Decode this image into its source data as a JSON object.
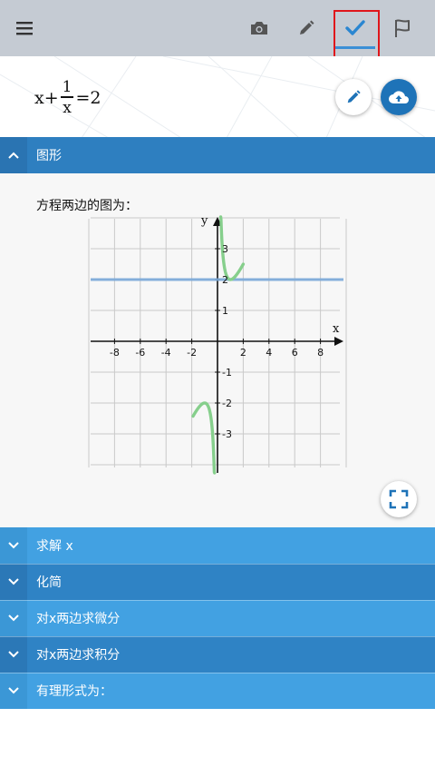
{
  "toolbar": {
    "icons": [
      "menu-icon",
      "camera-icon",
      "pencil-icon",
      "check-icon",
      "flag-icon"
    ],
    "active_tab": "check"
  },
  "equation": {
    "lhs": "x+",
    "numerator": "1",
    "denominator": "x",
    "rhs": "=2"
  },
  "graph_section": {
    "title": "图形",
    "caption": "方程两边的图为：",
    "x_axis_name": "x",
    "y_axis_name": "y",
    "x_ticks": [
      "-8",
      "-6",
      "-4",
      "-2",
      "2",
      "4",
      "6",
      "8"
    ],
    "y_ticks": [
      "3",
      "2",
      "1",
      "-1",
      "-2",
      "-3"
    ]
  },
  "sections": [
    {
      "label": "求解 x"
    },
    {
      "label": "化简"
    },
    {
      "label": "对x两边求微分"
    },
    {
      "label": "对x两边求积分"
    },
    {
      "label": "有理形式为："
    }
  ],
  "chart_data": {
    "type": "line",
    "xlim": [
      -10,
      10
    ],
    "ylim": [
      -4.3,
      3.9
    ],
    "grid": true,
    "series": [
      {
        "color": "#86cf8c",
        "function": "x + 1/x",
        "x_range_negative": [
          -1.9,
          -0.23
        ],
        "x_range_positive": [
          0.25,
          2
        ]
      },
      {
        "color": "#7aa8d8",
        "function": "2",
        "x_range": [
          -10,
          10
        ]
      }
    ]
  },
  "colors": {
    "toolbar_bg": "#c5cbd3",
    "highlight": "#e0161b",
    "header_dark": "#2e7fc0",
    "header_light": "#42a1e2",
    "curve_lhs": "#86cf8c",
    "curve_rhs": "#7aa8d8"
  }
}
